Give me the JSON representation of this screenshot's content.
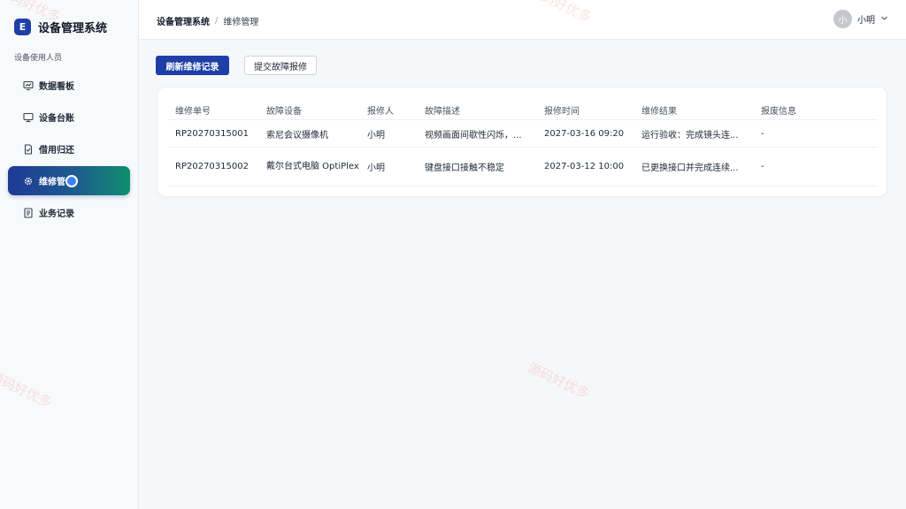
{
  "brand": {
    "logo_letter": "E",
    "title": "设备管理系统"
  },
  "sidebar": {
    "section_label": "设备使用人员",
    "items": [
      {
        "label": "数据看板",
        "icon": "dashboard-icon"
      },
      {
        "label": "设备台账",
        "icon": "monitor-icon"
      },
      {
        "label": "借用归还",
        "icon": "document-check-icon"
      },
      {
        "label": "维修管",
        "icon": "gear-icon",
        "active": true
      },
      {
        "label": "业务记录",
        "icon": "list-document-icon"
      }
    ]
  },
  "breadcrumb": {
    "root": "设备管理系统",
    "separator": "/",
    "current": "维修管理"
  },
  "user": {
    "avatar_text": "小",
    "name": "小明"
  },
  "toolbar": {
    "refresh_label": "刷新维修记录",
    "submit_label": "提交故障报修"
  },
  "table": {
    "headers": [
      "维修单号",
      "故障设备",
      "报修人",
      "故障描述",
      "报修时间",
      "维修结果",
      "报废信息"
    ],
    "rows": [
      {
        "id": "RP20270315001",
        "device": "索尼会议摄像机",
        "reporter": "小明",
        "description": "视频画面间歇性闪烁，...",
        "time": "2027-03-16 09:20",
        "result": "运行验收：完成镜头连...",
        "scrap": "-"
      },
      {
        "id": "RP20270315002",
        "device": "戴尔台式电脑 OptiPlex",
        "reporter": "小明",
        "description": "键盘接口接触不稳定",
        "time": "2027-03-12 10:00",
        "result": "已更换接口并完成连续...",
        "scrap": "-"
      }
    ]
  },
  "watermark": {
    "text": "源码好优多"
  },
  "colors": {
    "primary": "#1f3fa8",
    "active_gradient_end": "#0e8f6e"
  }
}
